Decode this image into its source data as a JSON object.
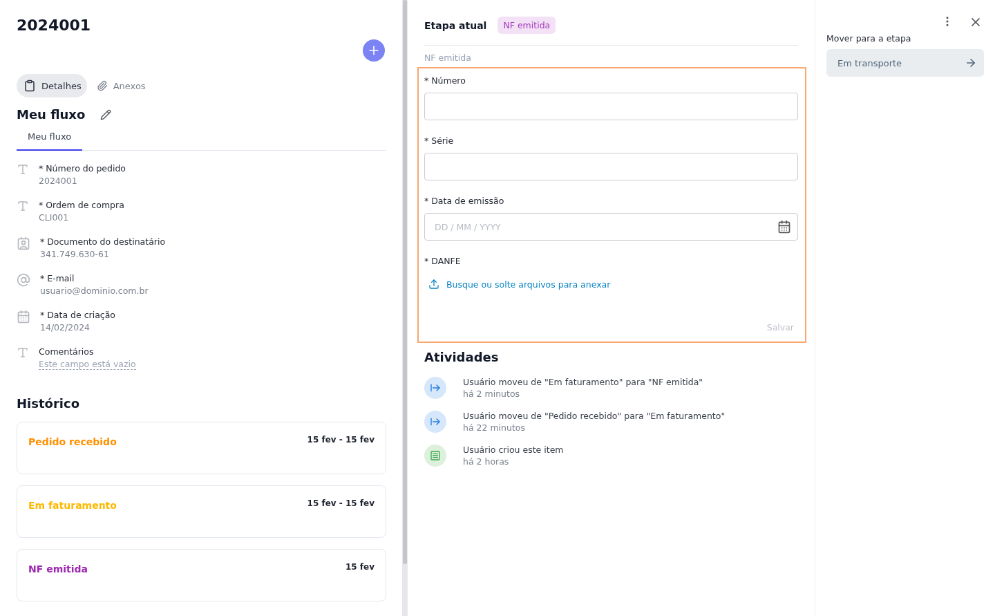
{
  "title": "2024001",
  "tabs": [
    {
      "label": "Detalhes",
      "selected": true
    },
    {
      "label": "Anexos",
      "selected": false
    }
  ],
  "flow": {
    "title": "Meu fluxo",
    "tabs": [
      {
        "label": "Meu fluxo",
        "selected": true
      }
    ]
  },
  "fields": [
    {
      "kind": "text",
      "label": "* Número do pedido",
      "value": "2024001",
      "empty": false
    },
    {
      "kind": "text",
      "label": "* Ordem de compra",
      "value": "CLI001",
      "empty": false
    },
    {
      "kind": "document",
      "label": "* Documento do destinatário",
      "value": "341.749.630-61",
      "empty": false
    },
    {
      "kind": "email",
      "label": "* E-mail",
      "value": "usuario@dominio.com.br",
      "empty": false
    },
    {
      "kind": "date",
      "label": "* Data de criação",
      "value": "14/02/2024",
      "empty": false
    },
    {
      "kind": "text",
      "label": "Comentários",
      "value": "Este campo está vazio",
      "empty": true
    }
  ],
  "history": {
    "title": "Histórico",
    "items": [
      {
        "name": "Pedido recebido",
        "dates": "15 fev - 15 fev",
        "color": "#ff9100"
      },
      {
        "name": "Em faturamento",
        "dates": "15 fev - 15 fev",
        "color": "#ffb800"
      },
      {
        "name": "NF emitida",
        "dates": "15 fev",
        "color": "#9c27b0"
      }
    ]
  },
  "current_stage": {
    "label": "Etapa atual",
    "badge": "NF emitida",
    "section": "NF emitida",
    "form": {
      "fields": [
        {
          "kind": "text",
          "label": "* Número"
        },
        {
          "kind": "text",
          "label": "* Série"
        },
        {
          "kind": "date",
          "label": "* Data de emissão",
          "placeholder": "DD / MM / YYYY"
        },
        {
          "kind": "file",
          "label": "* DANFE",
          "link": "Busque ou solte arquivos para anexar"
        }
      ],
      "save": {
        "label": "Salvar",
        "disabled": true
      }
    }
  },
  "activities": {
    "title": "Atividades",
    "items": [
      {
        "kind": "move",
        "text": "Usuário moveu de \"Em faturamento\" para \"NF emitida\"",
        "time": "há 2 minutos"
      },
      {
        "kind": "move",
        "text": "Usuário moveu de \"Pedido recebido\" para \"Em faturamento\"",
        "time": "há 22 minutos"
      },
      {
        "kind": "create",
        "text": "Usuário criou este item",
        "time": "há 2 horas"
      }
    ]
  },
  "move": {
    "label": "Mover para a etapa",
    "target": "Em transporte"
  }
}
